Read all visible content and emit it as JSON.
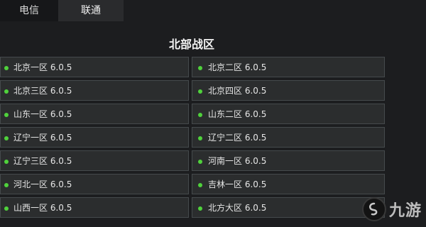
{
  "tabs": [
    {
      "label": "电信"
    },
    {
      "label": "联通"
    }
  ],
  "section_title": "北部战区",
  "servers": [
    {
      "name": "北京一区 6.0.5"
    },
    {
      "name": "北京二区 6.0.5"
    },
    {
      "name": "北京三区 6.0.5"
    },
    {
      "name": "北京四区 6.0.5"
    },
    {
      "name": "山东一区 6.0.5"
    },
    {
      "name": "山东二区 6.0.5"
    },
    {
      "name": "辽宁一区 6.0.5"
    },
    {
      "name": "辽宁二区 6.0.5"
    },
    {
      "name": "辽宁三区 6.0.5"
    },
    {
      "name": "河南一区 6.0.5"
    },
    {
      "name": "河北一区 6.0.5"
    },
    {
      "name": "吉林一区 6.0.5"
    },
    {
      "name": "山西一区 6.0.5"
    },
    {
      "name": "北方大区 6.0.5"
    }
  ],
  "status_color": "#4fd23c",
  "watermark": {
    "text": "九游",
    "icon": "jiuyou-logo-icon"
  }
}
